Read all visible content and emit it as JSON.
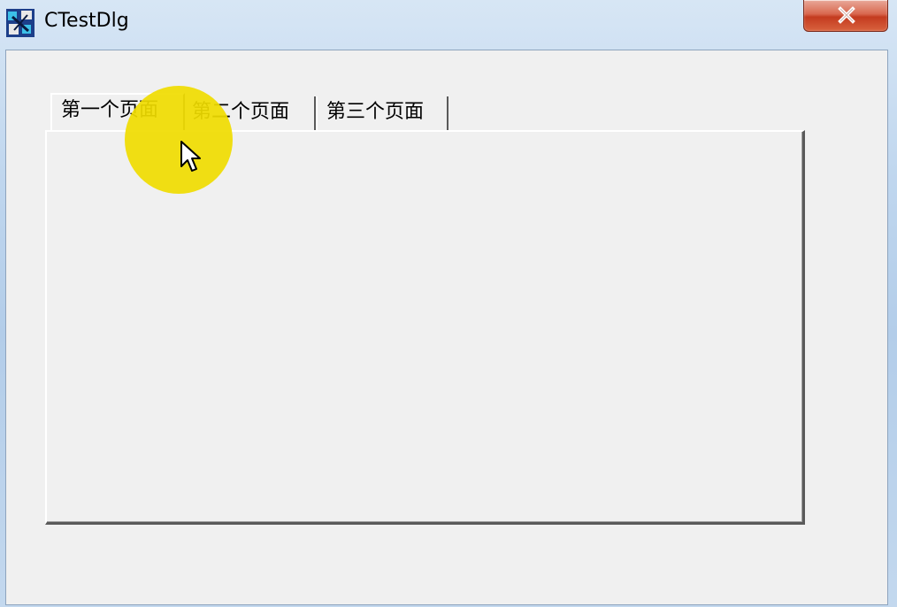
{
  "window": {
    "title": "CTestDlg",
    "icon": "mfc-app-icon",
    "close_icon": "close-x-icon"
  },
  "tabs": [
    {
      "label": "第一个页面",
      "selected": true
    },
    {
      "label": "第二个页面",
      "selected": false
    },
    {
      "label": "第三个页面",
      "selected": false
    }
  ],
  "colors": {
    "dialog_background": "#f0f0f0",
    "cursor_highlight": "#f0dc00",
    "close_button": "#c43b1f"
  }
}
